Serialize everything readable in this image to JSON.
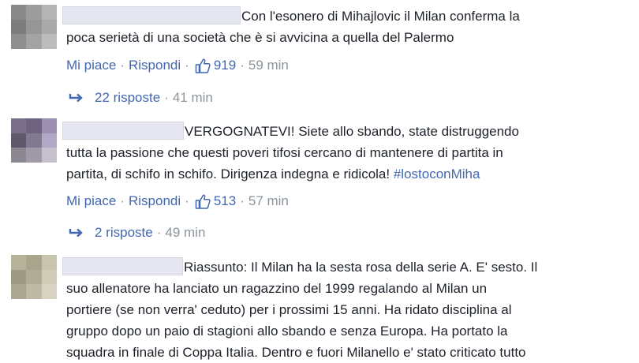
{
  "comments": [
    {
      "text": "Con l'esonero di Mihajlovic il Milan conferma la\npoca serietà di una società che è si avvicina a quella del Palermo",
      "like_label": "Mi piace",
      "reply_label": "Rispondi",
      "like_count": "919",
      "time": "59 min",
      "replies_label": "22 risposte",
      "replies_time": "41 min"
    },
    {
      "text_parts": [
        "VERGOGNATEVI! Siete allo sbando, state distruggendo\ntutta la passione che questi poveri tifosi cercano di mantenere di partita in\npartita, di schifo in schifo. Dirigenza indegna e ridicola! ",
        "#lostoconMiha"
      ],
      "like_label": "Mi piace",
      "reply_label": "Rispondi",
      "like_count": "513",
      "time": "57 min",
      "replies_label": "2 risposte",
      "replies_time": "49 min"
    },
    {
      "text": "Riassunto: Il Milan ha la sesta rosa della serie A. E' sesto. Il\nsuo allenatore ha lanciato un ragazzino del 1999 regalando al Milan un\nportiere (se non verra' ceduto) per i prossimi 15 anni. Ha ridato disciplina al\ngruppo dopo un paio di stagioni allo sbando e senza Europa. Ha portato la\nsquadra in finale di Coppa Italia. Dentro e fuori Milanello e' stato criticato tutto"
    }
  ],
  "separator": "·",
  "colors": {
    "link": "#4267b2",
    "meta": "#8d949e",
    "text": "#1d2129"
  },
  "icons": {
    "like": "thumbs-up-icon",
    "reply": "reply-arrow-icon"
  }
}
